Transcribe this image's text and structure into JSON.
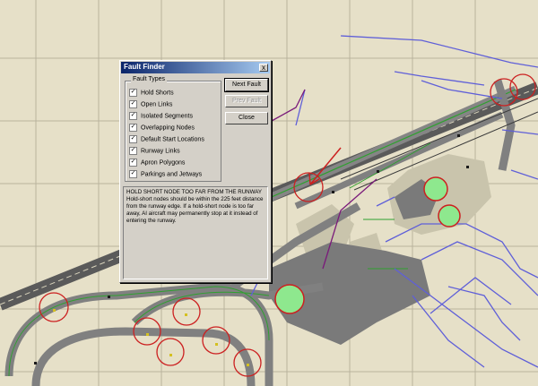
{
  "dialog": {
    "title": "Fault Finder",
    "close_glyph": "x",
    "group_label": "Fault Types",
    "checkboxes": [
      {
        "label": "Hold Shorts",
        "checked": true
      },
      {
        "label": "Open Links",
        "checked": true
      },
      {
        "label": "Isolated Segments",
        "checked": true
      },
      {
        "label": "Overlapping Nodes",
        "checked": true
      },
      {
        "label": "Default Start Locations",
        "checked": true
      },
      {
        "label": "Runway Links",
        "checked": true
      },
      {
        "label": "Apron Polygons",
        "checked": true
      },
      {
        "label": "Parkings and Jetways",
        "checked": true
      }
    ],
    "buttons": {
      "next": "Next Fault",
      "prev": "Prev Fault",
      "close": "Close"
    },
    "message_title": "HOLD SHORT NODE TOO FAR FROM THE RUNWAY",
    "message_body": "Hold-short nodes should be within the 225 feet distance from the runway edge. If a hold-short node is too far away, AI aircraft may permanently stop at it instead of entering the runway."
  },
  "colors": {
    "background": "#e6e0c8",
    "grid": "#b8b29c",
    "runway": "#5a5a5a",
    "taxiway": "#808080",
    "apron": "#c8c3ab",
    "path_blue": "#5f5fd8",
    "path_green": "#2fa02f",
    "highlight_red": "#cc2020",
    "parking_fill": "#8ee88e"
  }
}
